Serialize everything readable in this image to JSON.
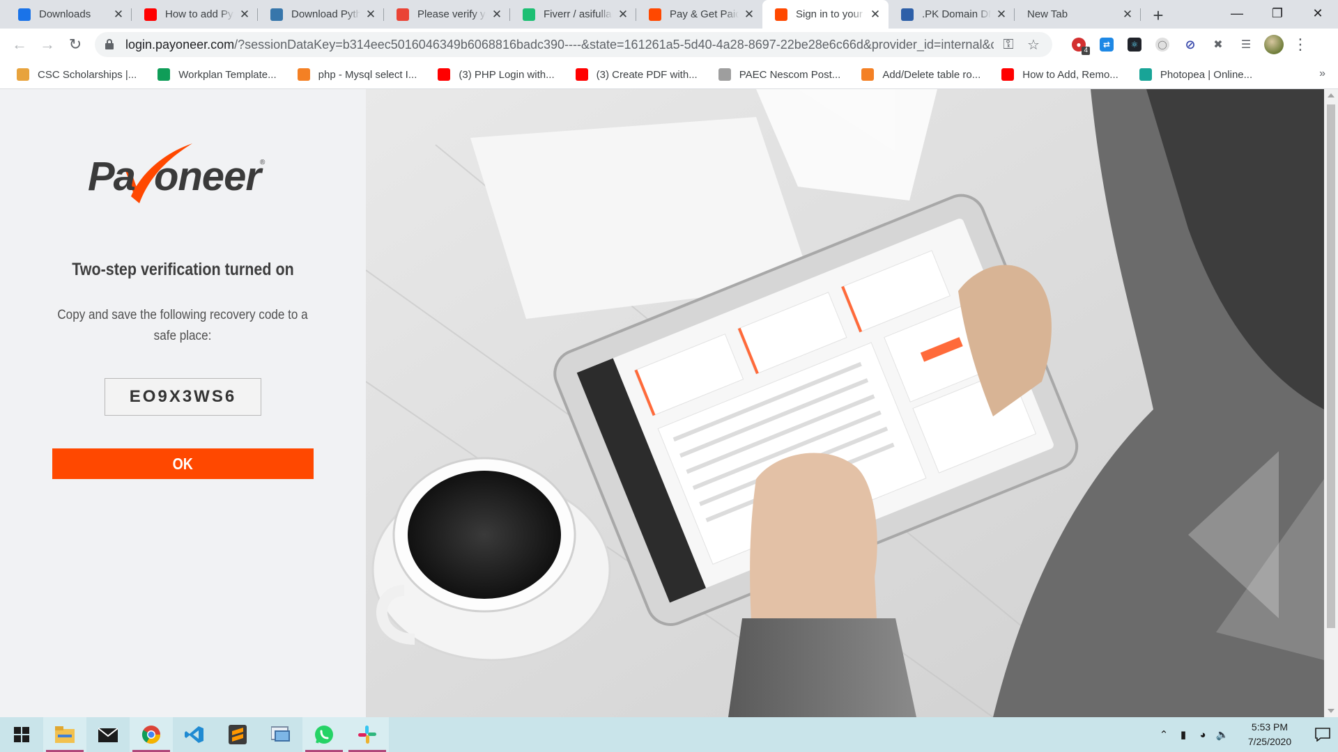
{
  "browser": {
    "tabs": [
      {
        "title": "Downloads",
        "icon": "download-icon",
        "color": "#1a73e8"
      },
      {
        "title": "How to add Pyt",
        "icon": "youtube-icon",
        "color": "#ff0000"
      },
      {
        "title": "Download Pyth",
        "icon": "python-icon",
        "color": "#3776ab"
      },
      {
        "title": "Please verify yo",
        "icon": "gmail-icon",
        "color": "#ea4335"
      },
      {
        "title": "Fiverr / asifullal",
        "icon": "fiverr-icon",
        "color": "#1dbf73"
      },
      {
        "title": "Pay & Get Paid",
        "icon": "payoneer-tab-icon",
        "color": "#ff4800"
      },
      {
        "title": "Sign in to your",
        "icon": "payoneer-tab-icon",
        "color": "#ff4800",
        "active": true
      },
      {
        "title": ".PK Domain DN",
        "icon": "pk-domain-icon",
        "color": "#2d5fa8"
      },
      {
        "title": "New Tab",
        "icon": "",
        "color": ""
      }
    ],
    "url_host": "login.payoneer.com",
    "url_rest": "/?sessionDataKey=b314eec5016046349b6068816badc390----&state=161261a5-5d40-4a28-8697-22be28e6c66d&provider_id=internal&client_i...",
    "extension_badge": "4"
  },
  "bookmarks": [
    {
      "label": "CSC Scholarships |...",
      "icon": "scholarship-icon",
      "color": "#e8a33d"
    },
    {
      "label": "Workplan Template...",
      "icon": "sheets-plus-icon",
      "color": "#0f9d58"
    },
    {
      "label": "php - Mysql select I...",
      "icon": "stackoverflow-icon",
      "color": "#f48024"
    },
    {
      "label": "(3) PHP Login with...",
      "icon": "youtube-icon",
      "color": "#ff0000"
    },
    {
      "label": "(3) Create PDF with...",
      "icon": "youtube-icon",
      "color": "#ff0000"
    },
    {
      "label": "PAEC Nescom Post...",
      "icon": "paec-icon",
      "color": "#9e9e9e"
    },
    {
      "label": "Add/Delete table ro...",
      "icon": "stackoverflow-icon",
      "color": "#f48024"
    },
    {
      "label": "How to Add, Remo...",
      "icon": "youtube-icon",
      "color": "#ff0000"
    },
    {
      "label": "Photopea | Online...",
      "icon": "photopea-icon",
      "color": "#18a497"
    }
  ],
  "page": {
    "logo_text": "Payoneer",
    "title": "Two-step verification turned on",
    "description": "Copy and save the following recovery code to a safe place:",
    "recovery_code": "EO9X3WS6",
    "ok_label": "OK",
    "accent": "#ff4800"
  },
  "taskbar": {
    "time": "5:53 PM",
    "date": "7/25/2020",
    "apps": [
      "windows-start-icon",
      "file-explorer-icon",
      "mail-icon",
      "chrome-icon",
      "vscode-icon",
      "sublime-text-icon",
      "remote-desktop-icon",
      "whatsapp-icon",
      "slack-icon"
    ]
  }
}
